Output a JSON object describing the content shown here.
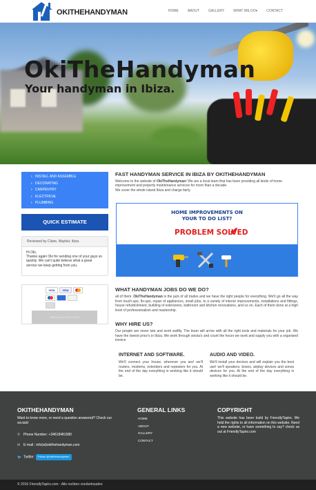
{
  "brand": {
    "name": "OKITHEHANDYMAN"
  },
  "nav": {
    "items": [
      "HOME",
      "ABOUT",
      "GALLERY",
      "WHAT WE DO▾",
      "CONTACT"
    ]
  },
  "hero": {
    "title": "OkiTheHandyman",
    "subtitle": "Your handyman in Ibiza."
  },
  "sidebar": {
    "services": [
      "INSTALL AND ASSEMBLE",
      "DECORATING",
      "CARPENTRY",
      "ELECTRICAL",
      "PLUMBING"
    ],
    "quick_estimate": "QUICK ESTIMATE",
    "review": {
      "header": "Reviewed by Claire, Mayfair, Ibiza",
      "greeting": "Hi Oki,",
      "text": "Thanks again Oki for sending one of your guys so quickly. We can't quite believe what a great service we keep getting from you."
    },
    "payment": {
      "cards": [
        "VISA",
        "VISA",
        "",
        "",
        "",
        "",
        ""
      ],
      "badge": "Website by HTML.COM"
    }
  },
  "main": {
    "heading1": "FAST HANDYMAN SERVICE IN IBIZA BY OKITHEHANDYMAN",
    "intro_a": "Welcome to the website of ",
    "intro_name": "OkiTheHandyman",
    "intro_b": "! We are a local team that has been providing all kinds of home improvement and property maintenance services for more than a decade.",
    "intro_c": "We cover the whole island Ibiza and charge fairly.",
    "banner": {
      "line1": "HOME IMPROVEMENTS ON",
      "line2": "YOUR TO DO LIST?",
      "solved": "PROBLEM SOLVED"
    },
    "heading2": "WHAT HANDYMAN JOBS DO WE DO?",
    "jobs_a": "all of them. ",
    "jobs_name": "OkiTheHandyman",
    "jobs_b": " is the jack of all trades and we have the right people for everything. We'll go all the way from touch-ups, fix-ups, repair of appliances, small jobs, to a variety of interior improvements, installations and fittings, house refurbishment, building of extensions, bathroom and kitchen renovations, and so on. Each of them done at a high level of professionalism and mastership.",
    "heading3": "WHY HIRE US?",
    "why": "Our people are never late and work swiftly. The team will arrive with all the right tools and materials for your job. We have the lowest price's in Ibiza. We work through siesta's and count the hours we work and supply you with a organised invoice",
    "internet_title": "INTERNET AND SOFTWARE.",
    "internet_text": "We'll connect your house, wherever you are! we'll routers, modems, extenders and repeaters for you. At the end of the day everything is working like it should be.",
    "audio_title": "AUDIO AND VIDEO.",
    "audio_text": "We'll install your devices and will explain you the best use! we'll speakers, boxes, airplay devices and sonos devices for you. At the end of the day everything is working like it should be."
  },
  "footer": {
    "col1_title": "OKITHEHANDYMAN",
    "col1_text": "Want to know more, or need a question answered? Check our socials!",
    "phone": "Phone Number: +34618481580",
    "email": "E-mail : info(at)okithehandyman.com",
    "twitter_label": "Twitter:",
    "twitter_button": "Follow @okithehandyman",
    "col2_title": "GENERAL LINKS",
    "links": [
      "HOME",
      "ABOUT",
      "GALLERY",
      "CONTACT"
    ],
    "col3_title": "COPYRIGHT",
    "col3_text": "This website has been build by FriendlyTapirs. We hold the rights to all information on this website. Need a new website, or have something to say? check us out at FriendlyTapirs.com",
    "bottom": "© 2016 FriendlyTapirs.com - Alle rechten voorbehouden"
  },
  "colors": {
    "accent": "#3b82f6",
    "dark_blue": "#1b54b3",
    "footer": "#3f4240",
    "red": "#e02020"
  }
}
